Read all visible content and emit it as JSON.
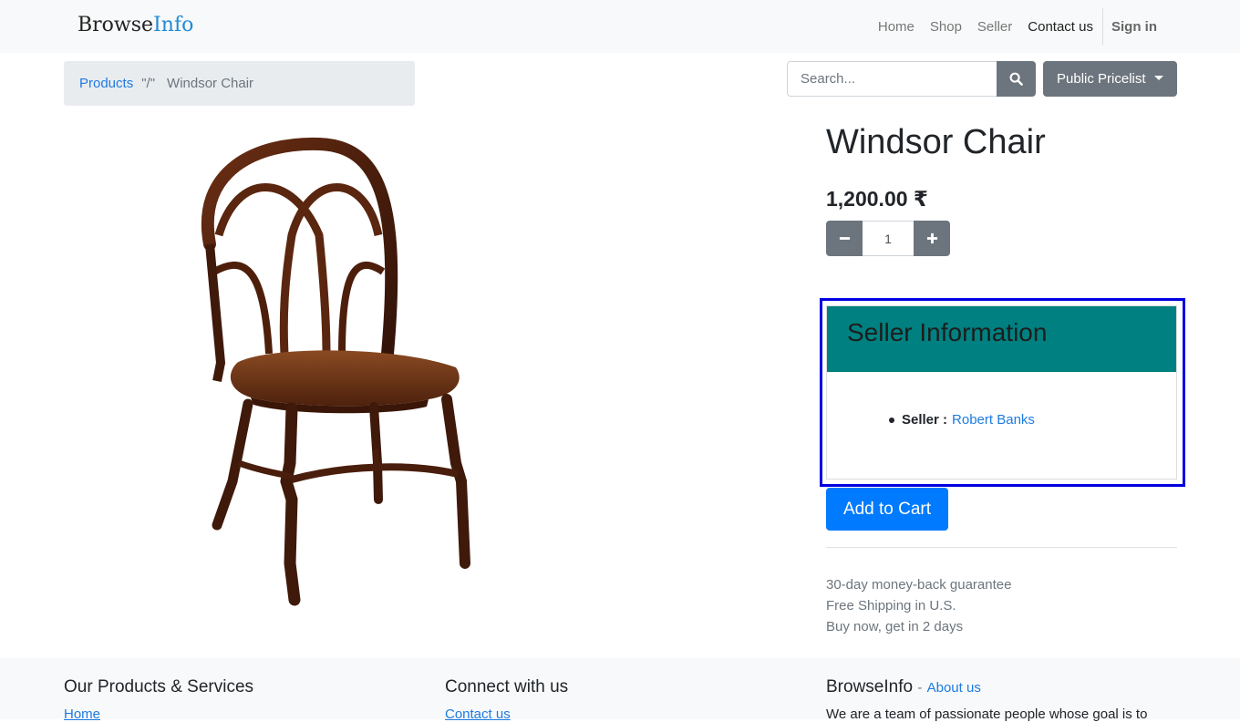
{
  "navbar": {
    "brand_part1": "Browse",
    "brand_part2": "Info",
    "links": [
      "Home",
      "Shop",
      "Seller",
      "Contact us"
    ],
    "signin": "Sign in"
  },
  "breadcrumb": {
    "parent": "Products",
    "separator": "\"/\"",
    "current": "Windsor Chair"
  },
  "search": {
    "placeholder": "Search...",
    "value": ""
  },
  "pricelist": {
    "label": "Public Pricelist"
  },
  "product": {
    "name": "Windsor Chair",
    "price": "1,200.00 ₹",
    "quantity": "1",
    "image_alt": "Windsor Chair"
  },
  "seller_info": {
    "title": "Seller Information",
    "label": "Seller :",
    "name": "Robert Banks"
  },
  "cart": {
    "add_label": "Add to Cart"
  },
  "features": [
    "30-day money-back guarantee",
    "Free Shipping in U.S.",
    "Buy now, get in 2 days"
  ],
  "footer": {
    "col1_title": "Our Products & Services",
    "col1_link": "Home",
    "col2_title": "Connect with us",
    "col2_link": "Contact us",
    "col3_title": "BrowseInfo",
    "col3_dash": "-",
    "col3_about": "About us",
    "col3_text": "We are a team of passionate people whose goal is to"
  },
  "colors": {
    "primary": "#007bff",
    "secondary": "#6c757d",
    "seller_header": "#008080",
    "highlight": "#0000e0",
    "link": "#1e7be0"
  }
}
